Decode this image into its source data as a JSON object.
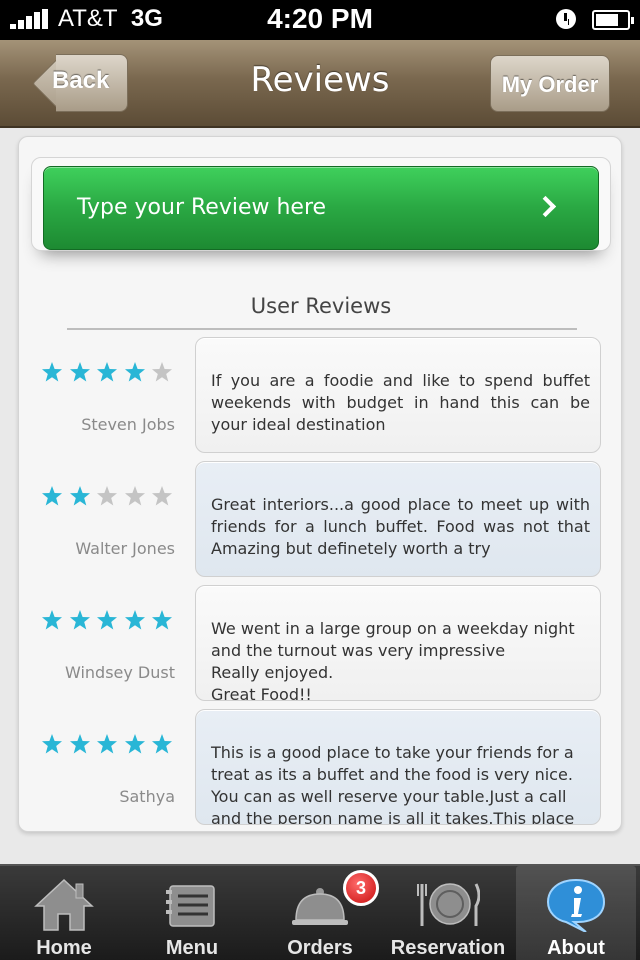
{
  "status_bar": {
    "carrier": "AT&T",
    "network": "3G",
    "time": "4:20 PM"
  },
  "nav": {
    "title": "Reviews",
    "back_label": "Back",
    "right_label": "My Order"
  },
  "review_button": {
    "label": "Type your Review here"
  },
  "section_title": "User Reviews",
  "reviews": [
    {
      "rating": 4,
      "max_rating": 5,
      "name": "Steven Jobs",
      "text": "If you are a foodie and like to spend buffet weekends with budget in hand this can be your ideal destination"
    },
    {
      "rating": 2,
      "max_rating": 5,
      "name": "Walter Jones",
      "text": "Great interiors...a good place to meet up with friends for a lunch buffet. Food was not that Amazing but definetely worth a try"
    },
    {
      "rating": 5,
      "max_rating": 5,
      "name": "Windsey Dust",
      "text": "We went in a large group on a weekday night and the turnout was very impressive\nReally enjoyed.\nGreat Food!!"
    },
    {
      "rating": 5,
      "max_rating": 5,
      "name": "Sathya",
      "text": "This is a good place to take your friends for a treat as its a buffet and the food is very nice.\nYou can as well reserve your table.Just a call and the person name is all it takes.This place also...."
    }
  ],
  "tabs": [
    {
      "label": "Home",
      "icon": "home-icon"
    },
    {
      "label": "Menu",
      "icon": "menu-icon"
    },
    {
      "label": "Orders",
      "icon": "cloche-icon"
    },
    {
      "label": "Reservation",
      "icon": "plate-icon"
    },
    {
      "label": "About",
      "icon": "info-icon"
    }
  ],
  "orders_badge": "3",
  "active_tab": "About",
  "colors": {
    "star_filled": "#29b6d6",
    "star_empty": "#c4c4c4",
    "accent_green": "#2aa843",
    "nav_brown": "#7a684f"
  }
}
